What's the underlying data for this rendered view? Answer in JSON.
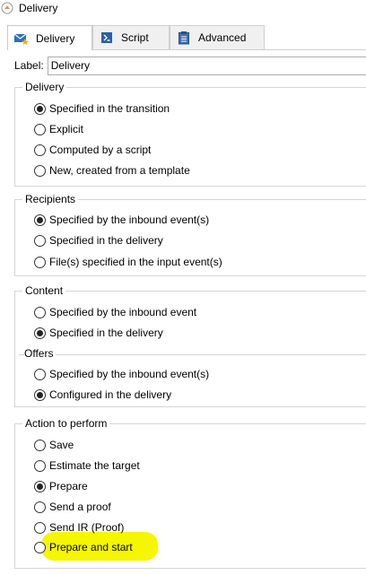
{
  "window": {
    "title": "Delivery"
  },
  "tabs": [
    {
      "label": "Delivery",
      "icon": "envelope-star-icon",
      "active": true
    },
    {
      "label": "Script",
      "icon": "script-icon",
      "active": false
    },
    {
      "label": "Advanced",
      "icon": "clipboard-icon",
      "active": false
    }
  ],
  "label_field": {
    "label": "Label:",
    "value": "Delivery"
  },
  "delivery_group": {
    "title": "Delivery",
    "options": [
      {
        "label": "Specified in the transition",
        "checked": true
      },
      {
        "label": "Explicit",
        "checked": false
      },
      {
        "label": "Computed by a script",
        "checked": false
      },
      {
        "label": "New, created from a template",
        "checked": false
      }
    ]
  },
  "recipients_group": {
    "title": "Recipients",
    "options": [
      {
        "label": "Specified by the inbound event(s)",
        "checked": true
      },
      {
        "label": "Specified in the delivery",
        "checked": false
      },
      {
        "label": "File(s) specified in the input event(s)",
        "checked": false
      }
    ]
  },
  "content_group": {
    "title": "Content",
    "options": [
      {
        "label": "Specified by the inbound event",
        "checked": false
      },
      {
        "label": "Specified in the delivery",
        "checked": true
      }
    ],
    "offers_title": "Offers",
    "offers_options": [
      {
        "label": "Specified by the inbound event(s)",
        "checked": false
      },
      {
        "label": "Configured in the delivery",
        "checked": true
      }
    ]
  },
  "action_group": {
    "title": "Action to perform",
    "options": [
      {
        "label": "Save",
        "checked": false
      },
      {
        "label": "Estimate the target",
        "checked": false
      },
      {
        "label": "Prepare",
        "checked": true
      },
      {
        "label": "Send a proof",
        "checked": false
      },
      {
        "label": "Send IR (Proof)",
        "checked": false
      },
      {
        "label": "Prepare and start",
        "checked": false,
        "highlighted": true
      }
    ]
  },
  "colors": {
    "highlight": "#f6f600",
    "border": "#d5d5d5",
    "tab_inactive": "#f0f0f0"
  }
}
